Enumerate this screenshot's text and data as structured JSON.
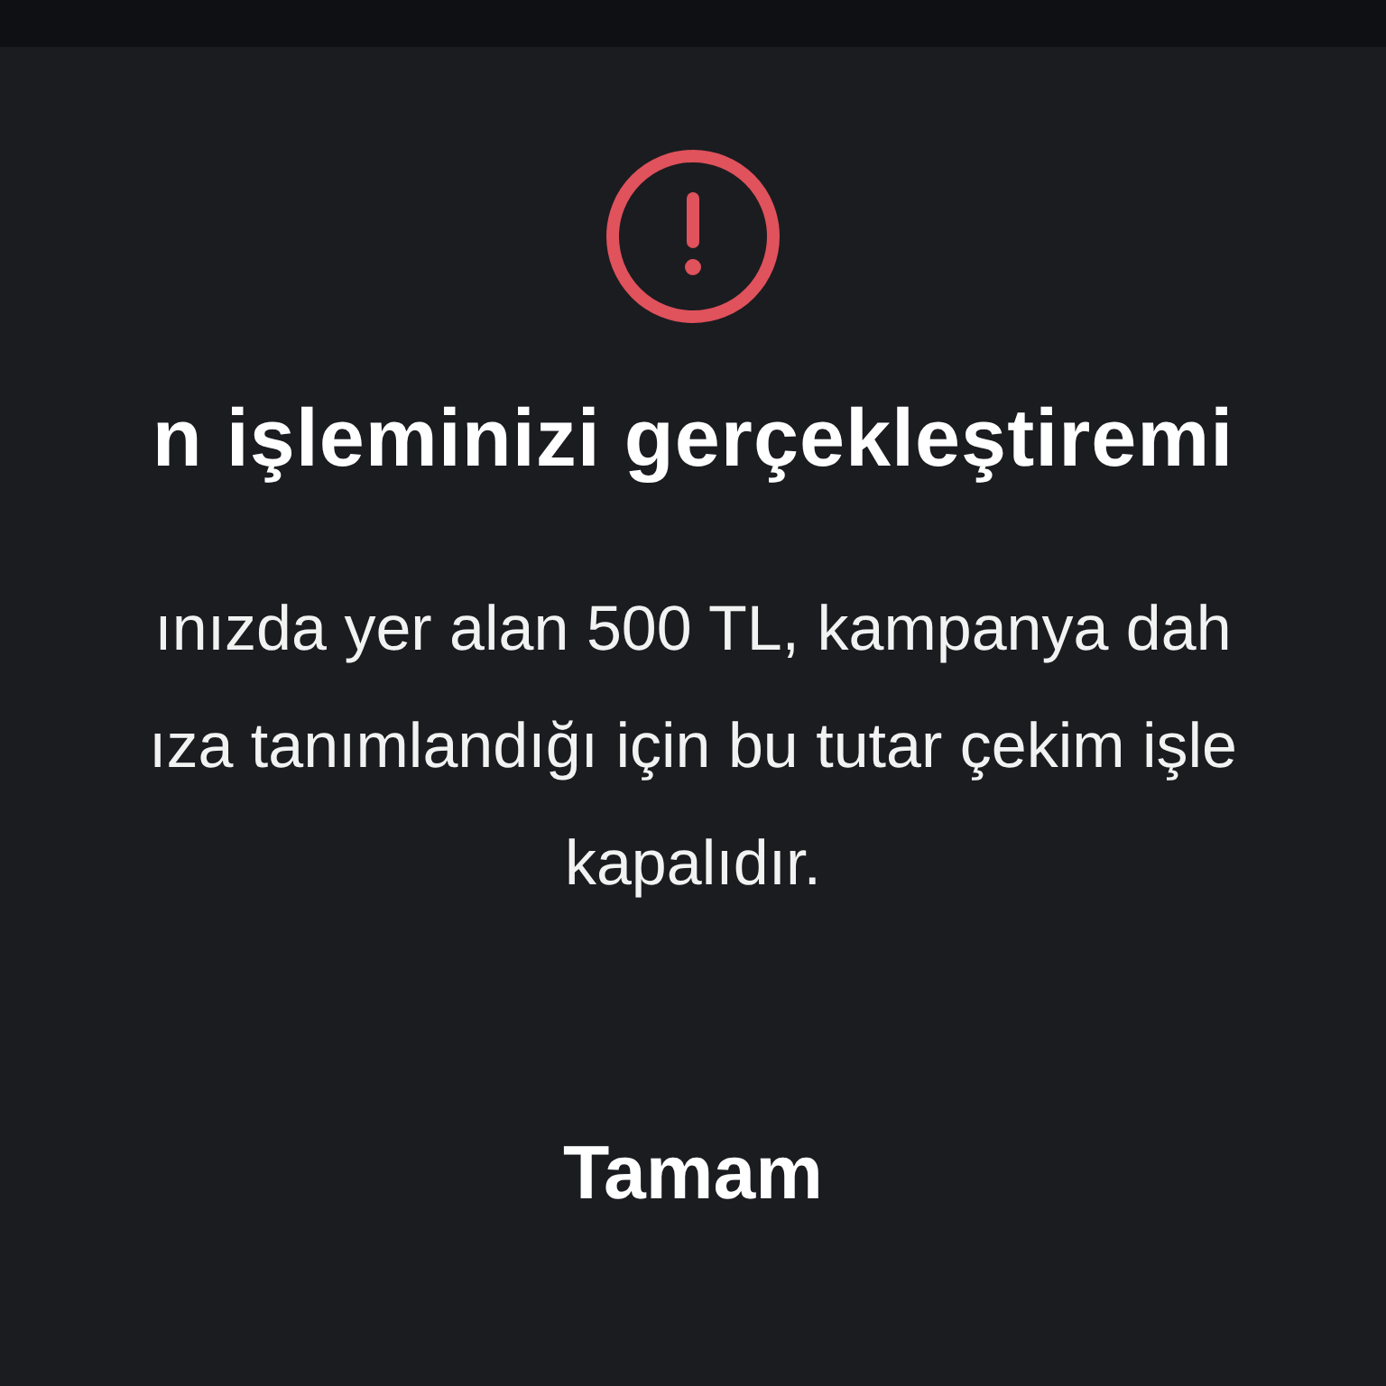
{
  "title": "n işleminizi gerçekleştiremi",
  "message": {
    "lines": [
      "ınızda yer alan 500 TL, kampanya dah",
      "ıza tanımlandığı için bu tutar çekim işle",
      "kapalıdır."
    ]
  },
  "button": {
    "label": "Tamam"
  }
}
